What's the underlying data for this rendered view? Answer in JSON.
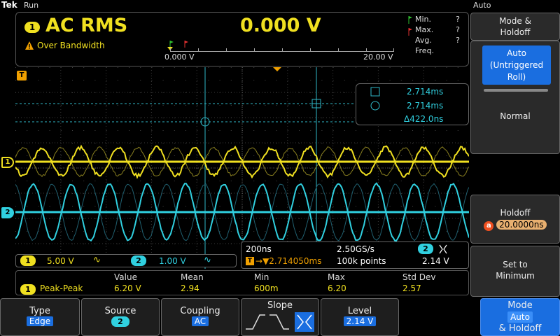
{
  "topbar": {
    "brand": "Tek",
    "run_state": "Run",
    "trigger_mode": "Auto"
  },
  "readout": {
    "channel": "1",
    "measurement_name": "AC RMS",
    "measurement_value": "0.000 V",
    "warning": "Over Bandwidth",
    "range_low": "0.000 V",
    "range_high": "20.00 V",
    "stats": [
      {
        "label": "Min.",
        "value": "?"
      },
      {
        "label": "Max.",
        "value": "?"
      },
      {
        "label": "Avg.",
        "value": "?"
      },
      {
        "label": "Freq.",
        "value": ""
      }
    ]
  },
  "markers": {
    "trigger": "T",
    "ch1": "1",
    "ch2": "2"
  },
  "cursor_readout": {
    "t1": "2.714ms",
    "t2": "2.714ms",
    "delta": "Δ422.0ns"
  },
  "channel_bar": {
    "ch1": "1",
    "ch1_scale": "5.00 V",
    "ch2": "2",
    "ch2_scale": "1.00 V"
  },
  "time_bar": {
    "horizontal": "200ns",
    "sample_rate": "2.50GS/s",
    "trig_channel": "2",
    "position": "▼2.714050ms",
    "record_length": "100k points",
    "trig_level": "2.14 V"
  },
  "measurement_table": {
    "headers": [
      "Value",
      "Mean",
      "Min",
      "Max",
      "Std Dev"
    ],
    "row": {
      "channel": "1",
      "name": "Peak-Peak",
      "values": [
        "6.20 V",
        "2.94",
        "600m",
        "6.20",
        "2.57"
      ]
    }
  },
  "side_menu": {
    "title": "Mode &\nHoldoff",
    "auto_label": "Auto\n(Untriggered\nRoll)",
    "normal_label": "Normal",
    "holdoff_label": "Holdoff",
    "holdoff_knob": "a",
    "holdoff_value": "20.0000ns",
    "set_min_label": "Set to\nMinimum"
  },
  "bottom_menu": {
    "type_label": "Type",
    "type_value": "Edge",
    "source_label": "Source",
    "source_value": "2",
    "coupling_label": "Coupling",
    "coupling_value": "AC",
    "slope_label": "Slope",
    "level_label": "Level",
    "level_value": "2.14 V",
    "mode_label": "Mode",
    "mode_value": "Auto",
    "mode_suffix": "& Holdoff"
  },
  "colors": {
    "ch1": "#f0e020",
    "ch2": "#30d0e0",
    "accent": "#1a6ee0",
    "warning": "#f0a000"
  }
}
